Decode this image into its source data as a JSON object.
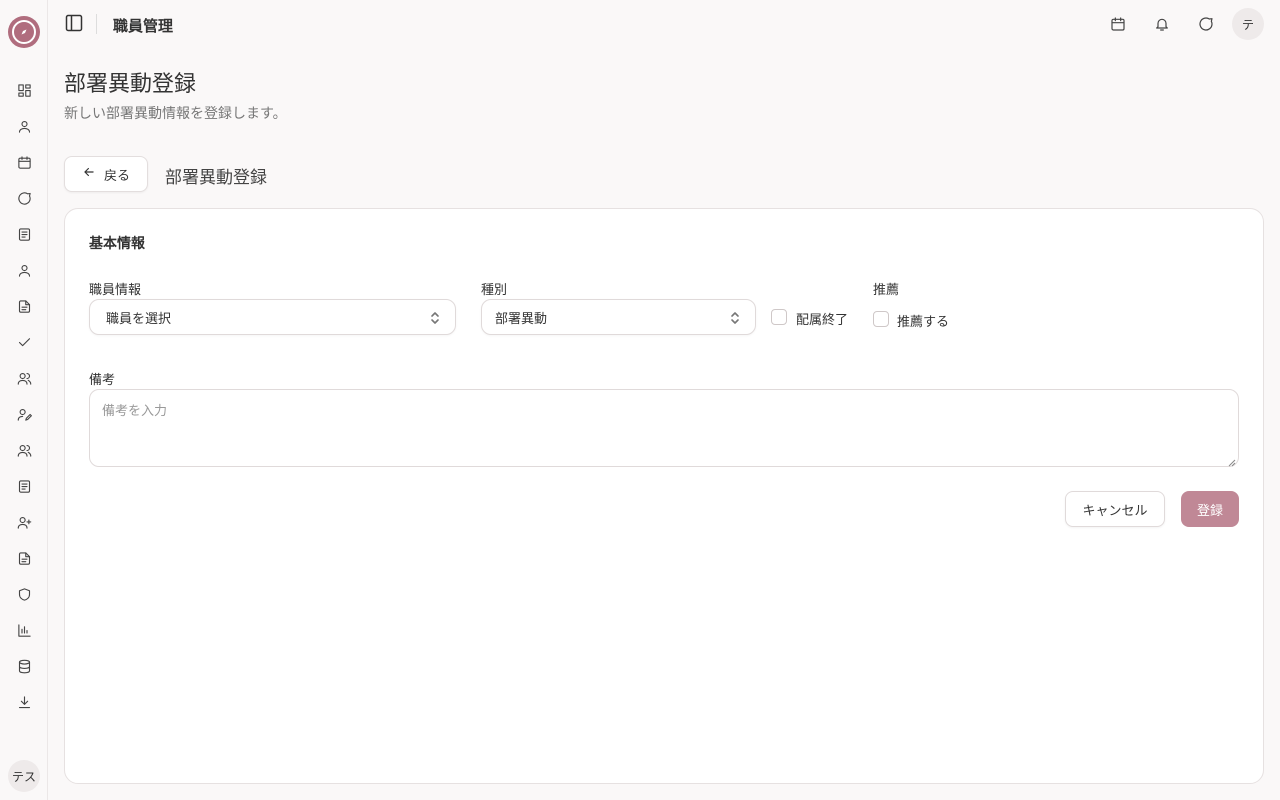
{
  "app": {
    "title": "職員管理",
    "avatar_initial": "テ",
    "sidebar_user": "テス"
  },
  "colors": {
    "accent": "#b06d7e",
    "submit_bg": "#c08896"
  },
  "sidebar": {
    "icons": [
      "dashboard-icon",
      "user-icon",
      "calendar-icon",
      "message-icon",
      "document-icon",
      "user-icon",
      "file-icon",
      "check-icon",
      "users-icon",
      "user-edit-icon",
      "users-icon",
      "document-icon",
      "user-plus-icon",
      "file-icon",
      "shield-icon",
      "chart-icon",
      "database-icon",
      "download-icon"
    ]
  },
  "header": {
    "icons": [
      "calendar-icon",
      "bell-icon",
      "message-icon"
    ]
  },
  "page": {
    "title": "部署異動登録",
    "subtitle": "新しい部署異動情報を登録します。",
    "back_label": "戻る",
    "section_heading": "部署異動登録"
  },
  "form": {
    "card_title": "基本情報",
    "staff_label": "職員情報",
    "staff_placeholder": "職員を選択",
    "type_label": "種別",
    "type_value": "部署異動",
    "end_label": "配属終了",
    "recommend_label": "推薦",
    "recommend_check_label": "推薦する",
    "notes_label": "備考",
    "notes_placeholder": "備考を入力",
    "cancel_label": "キャンセル",
    "submit_label": "登録"
  }
}
